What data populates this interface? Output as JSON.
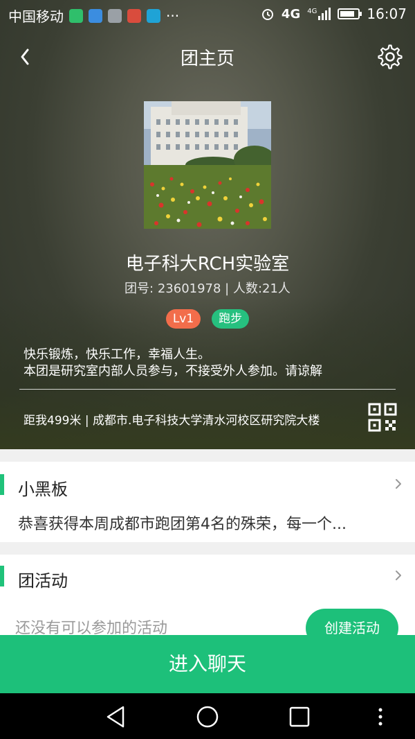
{
  "status_bar": {
    "carrier": "中国移动",
    "more": "···",
    "network": "4G",
    "network_small": "4G",
    "time": "16:07"
  },
  "header": {
    "title": "团主页",
    "back_icon": "back-arrow-icon",
    "settings_icon": "gear-icon"
  },
  "group": {
    "name": "电子科大RCH实验室",
    "meta": "团号: 23601978 | 人数:21人",
    "tags": [
      "Lv1",
      "跑步"
    ],
    "motto_line1": "快乐锻炼，快乐工作，幸福人生。",
    "motto_line2": "本团是研究室内部人员参与，不接受外人参加。请谅解",
    "location": "距我499米 | 成都市.电子科技大学清水河校区研究院大楼"
  },
  "blackboard": {
    "title": "小黑板",
    "content": "恭喜获得本周成都市跑团第4名的殊荣，每一个..."
  },
  "activities": {
    "title": "团活动",
    "empty_text": "还没有可以参加的活动",
    "create_label": "创建活动"
  },
  "bottom": {
    "enter_chat_label": "进入聊天"
  },
  "colors": {
    "accent_green": "#1dc07a",
    "tag_level": "#f26d4b",
    "tag_sport": "#26c07f"
  }
}
